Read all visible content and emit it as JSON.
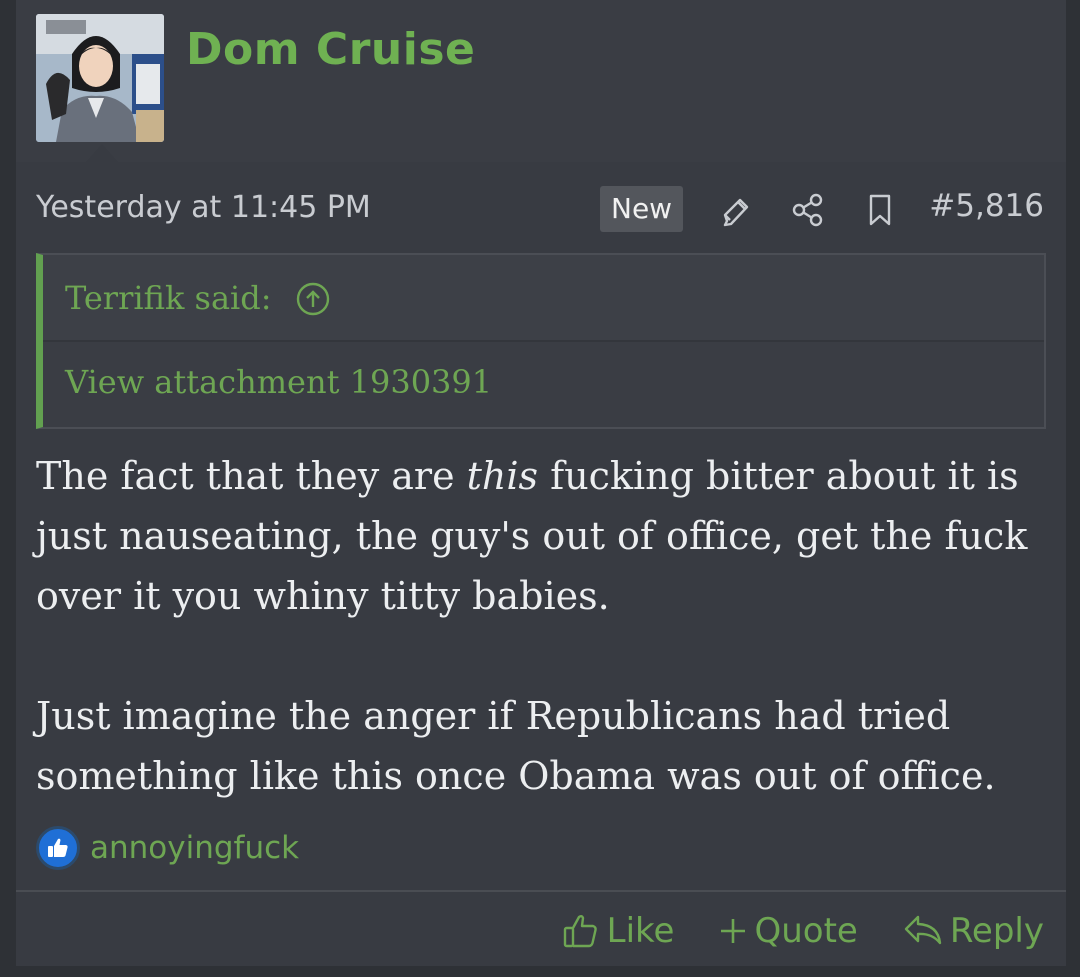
{
  "author": {
    "name": "Dom Cruise",
    "avatar_icon": "avatar-illustration"
  },
  "meta": {
    "timestamp": "Yesterday at 11:45 PM",
    "badge": "New",
    "post_number": "#5,816",
    "icons": [
      "highlight-icon",
      "share-icon",
      "bookmark-icon"
    ]
  },
  "quote": {
    "author_line": "Terrifik said:",
    "attachment_text": "View attachment 1930391"
  },
  "message": {
    "p1_before": "The fact that they are ",
    "p1_em": "this",
    "p1_after": " fucking bitter about it is just nauseating, the guy's out of office, get the fuck over it you whiny titty babies.",
    "p2": "Just imagine the anger if Republicans had tried something like this once Obama was out of office."
  },
  "reactions": {
    "icon": "like-reaction-icon",
    "users": "annoyingfuck"
  },
  "actions": {
    "like": "Like",
    "quote": "Quote",
    "reply": "Reply"
  },
  "colors": {
    "accent_green": "#6ea653",
    "background": "#383b42",
    "text": "#eceef0"
  }
}
